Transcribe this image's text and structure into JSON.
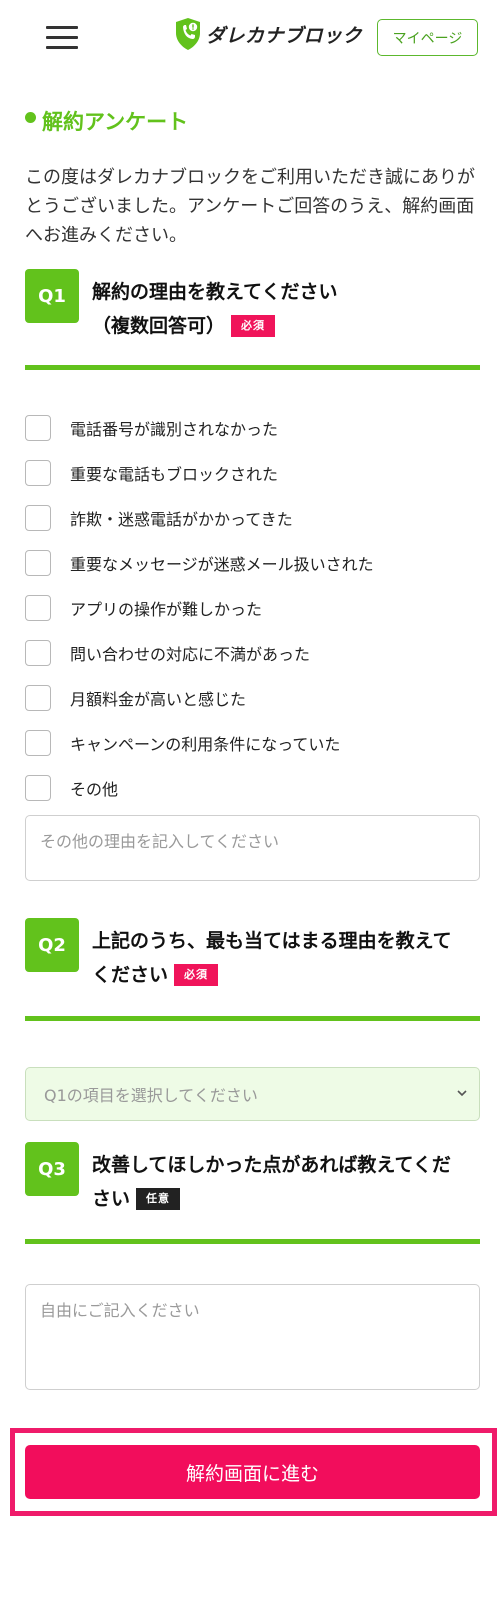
{
  "header": {
    "logo_text": "ダレカナブロック",
    "mypage_label": "マイページ"
  },
  "section": {
    "title": "解約アンケート",
    "intro": "この度はダレカナブロックをご利用いただき誠にありがとうございました。アンケートご回答のうえ、解約画面へお進みください。"
  },
  "q1": {
    "badge": "Q1",
    "title_line1": "解約の理由を教えてください",
    "title_line2": "（複数回答可）",
    "tag": "必須",
    "options": [
      "電話番号が識別されなかった",
      "重要な電話もブロックされた",
      "詐欺・迷惑電話がかかってきた",
      "重要なメッセージが迷惑メール扱いされた",
      "アプリの操作が難しかった",
      "問い合わせの対応に不満があった",
      "月額料金が高いと感じた",
      "キャンペーンの利用条件になっていた",
      "その他"
    ],
    "other_placeholder": "その他の理由を記入してください"
  },
  "q2": {
    "badge": "Q2",
    "title_line1": "上記のうち、最も当てはまる理由を教えて",
    "title_line2": "ください",
    "tag": "必須",
    "select_placeholder": "Q1の項目を選択してください"
  },
  "q3": {
    "badge": "Q3",
    "title_line1": "改善してほしかった点があれば教えてくだ",
    "title_line2": "さい",
    "tag": "任意",
    "placeholder": "自由にご記入ください"
  },
  "cta": {
    "label": "解約画面に進む"
  },
  "colors": {
    "brand_green": "#62c21c",
    "required_pink": "#f0145a",
    "cta_pink": "#f20d5c"
  }
}
